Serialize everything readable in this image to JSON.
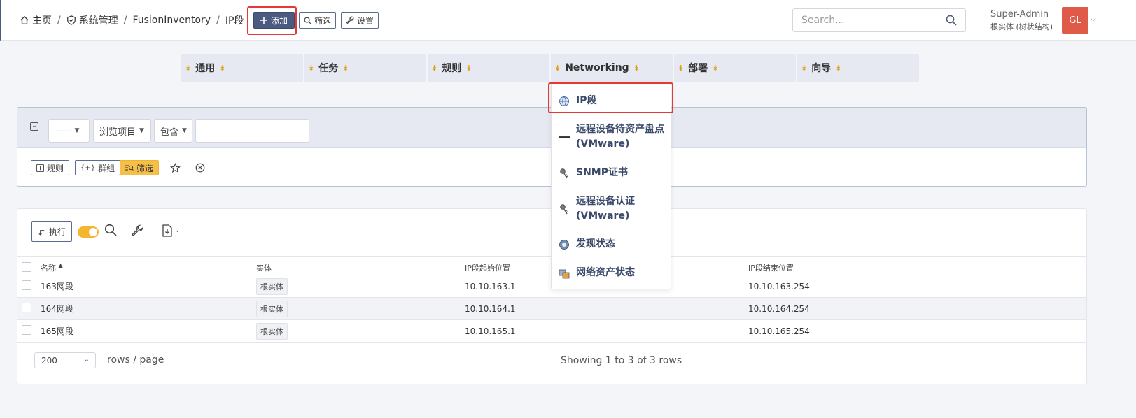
{
  "breadcrumb": {
    "home": "主页",
    "admin": "系统管理",
    "plugin": "FusionInventory",
    "current": "IP段"
  },
  "toolbar": {
    "add_label": "添加",
    "filter_label": "筛选",
    "settings_label": "设置"
  },
  "search": {
    "placeholder": "Search..."
  },
  "user": {
    "name": "Super-Admin",
    "entity": "根实体 (树状结构)",
    "initials": "GL",
    "avatar_color": "#e05a4a"
  },
  "menu": {
    "items": [
      {
        "label": "通用"
      },
      {
        "label": "任务"
      },
      {
        "label": "规则"
      },
      {
        "label": "Networking"
      },
      {
        "label": "部署"
      },
      {
        "label": "向导"
      }
    ]
  },
  "dropdown": {
    "items": [
      {
        "label": "IP段",
        "icon": "globe-icon"
      },
      {
        "label": "远程设备待资产盘点 (VMware)",
        "icon": "server-icon"
      },
      {
        "label": "SNMP证书",
        "icon": "key-icon"
      },
      {
        "label": "远程设备认证 (VMware)",
        "icon": "key-icon"
      },
      {
        "label": "发现状态",
        "icon": "discovery-icon"
      },
      {
        "label": "网络资产状态",
        "icon": "inventory-icon"
      }
    ]
  },
  "filter": {
    "field_value": "-----",
    "item_value": "浏览项目",
    "operator_value": "包含",
    "rule_label": "规则",
    "group_label": "群组",
    "search_label": "筛选"
  },
  "table": {
    "execute_label": "执行",
    "columns": [
      "名称",
      "实体",
      "IP段起始位置",
      "IP段结束位置"
    ],
    "rows": [
      {
        "name": "163网段",
        "entity": "根实体",
        "start": "10.10.163.1",
        "end": "10.10.163.254"
      },
      {
        "name": "164网段",
        "entity": "根实体",
        "start": "10.10.164.1",
        "end": "10.10.164.254"
      },
      {
        "name": "165网段",
        "entity": "根实体",
        "start": "10.10.165.1",
        "end": "10.10.165.254"
      }
    ]
  },
  "pagination": {
    "page_size": "200",
    "rows_label": "rows / page",
    "showing": "Showing 1 to 3 of 3 rows"
  },
  "colors": {
    "accent": "#4b5b7f",
    "highlight": "#e53935",
    "chevron": "#e0a21a",
    "filter_active": "#f5c04a"
  }
}
